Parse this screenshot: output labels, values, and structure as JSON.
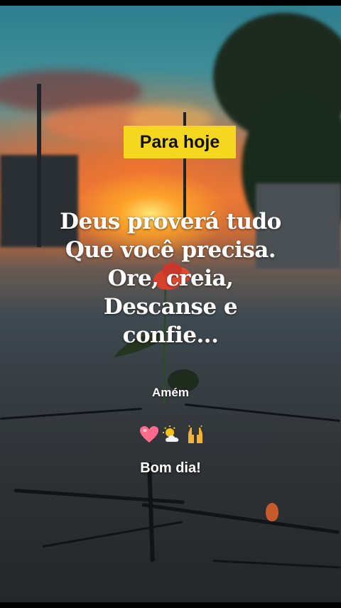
{
  "tag": {
    "label": "Para hoje"
  },
  "message": {
    "lines": [
      "Deus proverá tudo",
      "Que você precisa.",
      "Ore, creia,",
      "Descanse e",
      "confie..."
    ]
  },
  "amen": "Amém",
  "emojis": [
    "heart-icon",
    "sun-behind-cloud-icon",
    "raising-hands-icon"
  ],
  "greeting": "Bom dia!",
  "colors": {
    "tag_bg": "#f6d71f",
    "text": "#ffffff",
    "sky": "#2e7f8e",
    "sunset": "#e2783a"
  }
}
